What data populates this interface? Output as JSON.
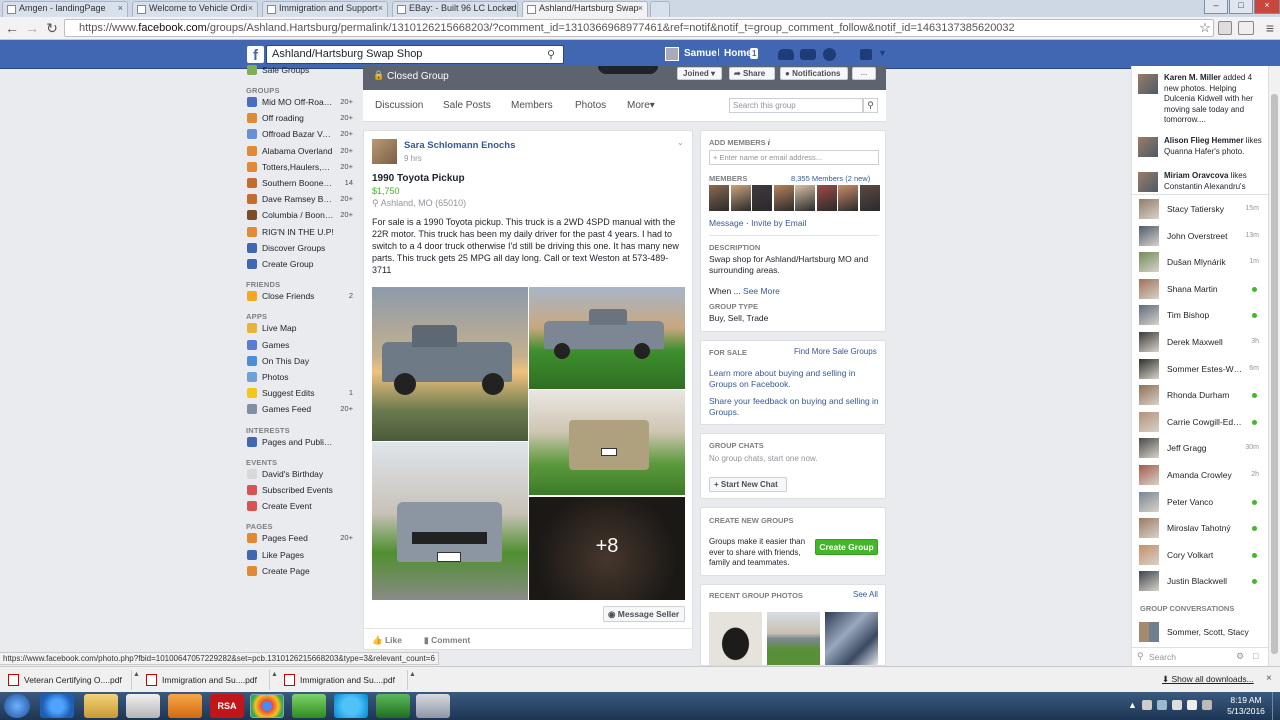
{
  "browser": {
    "tabs": [
      {
        "label": "Amgen - landingPage",
        "active": false
      },
      {
        "label": "Welcome to Vehicle Ordi",
        "active": false
      },
      {
        "label": "Immigration and Support",
        "active": false
      },
      {
        "label": "EBay: - Built 96 LC Locked",
        "active": false
      },
      {
        "label": "Ashland/Hartsburg Swap",
        "active": true
      }
    ],
    "url_prefix": "https://www.",
    "url_domain": "facebook.com",
    "url_rest": "/groups/Ashland.Hartsburg/permalink/1310126215668203/?comment_id=1310366968977461&ref=notif&notif_t=group_comment_follow&notif_id=1463137385620032"
  },
  "fb": {
    "search_value": "Ashland/Hartsburg Swap Shop",
    "user_name": "Samuel",
    "home_label": "Home",
    "home_count": "1"
  },
  "left_nav": {
    "top_item": "Sale Groups",
    "groups_header": "GROUPS",
    "groups": [
      {
        "label": "Mid MO Off-Road ...",
        "count": "20+",
        "color": "#4b6dbf"
      },
      {
        "label": "Off roading",
        "count": "20+",
        "color": "#e08a36"
      },
      {
        "label": "Offroad Bazar Veci...",
        "count": "20+",
        "color": "#6a8fd6"
      },
      {
        "label": "Alabama Overland",
        "count": "20+",
        "color": "#e08a36"
      },
      {
        "label": "Totters,Haulers,To...",
        "count": "20+",
        "color": "#e08a36"
      },
      {
        "label": "Southern Boone Ch...",
        "count": "14",
        "color": "#c46b2f"
      },
      {
        "label": "Dave Ramsey Bab...",
        "count": "20+",
        "color": "#c46b2f"
      },
      {
        "label": "Columbia / Boone ...",
        "count": "20+",
        "color": "#7a4d2b"
      },
      {
        "label": "RIG'N IN THE U.P!",
        "count": "",
        "color": "#e08a36"
      },
      {
        "label": "Discover Groups",
        "count": "",
        "color": "#4267b2"
      },
      {
        "label": "Create Group",
        "count": "",
        "color": "#4267b2"
      }
    ],
    "friends_header": "FRIENDS",
    "friends": [
      {
        "label": "Close Friends",
        "count": "2",
        "color": "#f5a623"
      }
    ],
    "apps_header": "APPS",
    "apps": [
      {
        "label": "Live Map",
        "count": "",
        "color": "#e8b339"
      },
      {
        "label": "Games",
        "count": "",
        "color": "#5b7bd5"
      },
      {
        "label": "On This Day",
        "count": "",
        "color": "#4b8ed9"
      },
      {
        "label": "Photos",
        "count": "",
        "color": "#6fa0d8"
      },
      {
        "label": "Suggest Edits",
        "count": "1",
        "color": "#f5c518"
      },
      {
        "label": "Games Feed",
        "count": "20+",
        "color": "#7f8fa6"
      }
    ],
    "interests_header": "INTERESTS",
    "interests": [
      {
        "label": "Pages and Public F...",
        "count": "",
        "color": "#4267b2"
      }
    ],
    "events_header": "EVENTS",
    "events": [
      {
        "label": "David's Birthday",
        "count": "",
        "color": "#d9d9d9"
      },
      {
        "label": "Subscribed Events",
        "count": "",
        "color": "#d9534f"
      },
      {
        "label": "Create Event",
        "count": "",
        "color": "#d9534f"
      }
    ],
    "pages_header": "PAGES",
    "pages": [
      {
        "label": "Pages Feed",
        "count": "20+",
        "color": "#e08a36"
      },
      {
        "label": "Like Pages",
        "count": "",
        "color": "#4267b2"
      },
      {
        "label": "Create Page",
        "count": "",
        "color": "#e08a36"
      }
    ]
  },
  "group": {
    "privacy": "Closed Group",
    "joined_label": "Joined",
    "share_label": "Share",
    "notifications_label": "Notifications",
    "more_dots": "...",
    "tabs": [
      "Discussion",
      "Sale Posts",
      "Members",
      "Photos",
      "More"
    ],
    "search_placeholder": "Search this group"
  },
  "post": {
    "author": "Sara Schlomann Enochs",
    "time": "9 hrs",
    "title": "1990 Toyota Pickup",
    "price": "$1,750",
    "location": "Ashland, MO (65010)",
    "body": "For sale is a 1990 Toyota pickup. This truck is a 2WD 4SPD manual with the 22R motor. This truck has been my daily driver for the past 4 years. I had to switch to a 4 door truck otherwise I'd still be driving this one. It has many new parts. This truck gets 25 MPG all day long. Call or text Weston at 573-489-3711",
    "more_photos": "+8",
    "message_seller": "Message Seller",
    "like_label": "Like",
    "comment_label": "Comment"
  },
  "right": {
    "add_members_header": "ADD MEMBERS",
    "add_members_placeholder": "+ Enter name or email address...",
    "members_header": "MEMBERS",
    "members_count": "8,355 Members (2 new)",
    "message_link": "Message",
    "invite_link": "Invite by Email",
    "description_header": "DESCRIPTION",
    "description": "Swap shop for Ashland/Hartsburg MO and surrounding areas.",
    "when_text": "When ...",
    "see_more": "See More",
    "group_type_header": "GROUP TYPE",
    "group_type": "Buy, Sell, Trade",
    "for_sale_header": "FOR SALE",
    "find_more": "Find More Sale Groups",
    "learn_more": "Learn more about buying and selling in Groups on Facebook.",
    "share_feedback": "Share your feedback on buying and selling in Groups.",
    "group_chats_header": "GROUP CHATS",
    "no_chats": "No group chats, start one now.",
    "start_chat": "+ Start New Chat",
    "create_groups_header": "CREATE NEW GROUPS",
    "create_groups_text": "Groups make it easier than ever to share with friends, family and teammates.",
    "create_group_btn": "Create Group",
    "recent_photos_header": "RECENT GROUP PHOTOS",
    "see_all": "See All"
  },
  "chat": {
    "tickers": [
      {
        "name": "Karen M. Miller",
        "text": " added 4 new photos. Helping Dulcenia Kidwell with her moving sale today and tomorrow...."
      },
      {
        "name": "Alison Flieg Hemmer",
        "text": " likes Quanna Hafer's photo."
      },
      {
        "name": "Miriam Oravcova",
        "text": " likes Constantin Alexandru's"
      }
    ],
    "contacts": [
      {
        "name": "Stacy Tatiersky",
        "status": "15m",
        "online": false
      },
      {
        "name": "John Overstreet",
        "status": "13m",
        "online": false
      },
      {
        "name": "Dušan Mlynárik",
        "status": "1m",
        "online": false
      },
      {
        "name": "Shana Martin",
        "status": "",
        "online": true
      },
      {
        "name": "Tim Bishop",
        "status": "",
        "online": true
      },
      {
        "name": "Derek Maxwell",
        "status": "3h",
        "online": false
      },
      {
        "name": "Sommer Estes-Wiley",
        "status": "6m",
        "online": false
      },
      {
        "name": "Rhonda Durham",
        "status": "",
        "online": true
      },
      {
        "name": "Carrie Cowgill-Edw...",
        "status": "",
        "online": true
      },
      {
        "name": "Jeff Gragg",
        "status": "30m",
        "online": false
      },
      {
        "name": "Amanda Crowley",
        "status": "2h",
        "online": false
      },
      {
        "name": "Peter Vanco",
        "status": "",
        "online": true
      },
      {
        "name": "Miroslav Tahotný",
        "status": "",
        "online": true
      },
      {
        "name": "Cory Volkart",
        "status": "",
        "online": true
      },
      {
        "name": "Justin Blackwell",
        "status": "",
        "online": true
      }
    ],
    "conversations_header": "GROUP CONVERSATIONS",
    "conversation": "Sommer, Scott, Stacy",
    "search_placeholder": "Search"
  },
  "status_url": "https://www.facebook.com/photo.php?fbid=10100647057229282&set=pcb.1310126215668203&type=3&relevant_count=6",
  "downloads": {
    "items": [
      "Veteran Certifying O....pdf",
      "Immigration and Su....pdf",
      "Immigration and Su....pdf"
    ],
    "show_all": "Show all downloads..."
  },
  "taskbar": {
    "rsa_label": "RSA",
    "time": "8:19 AM",
    "date": "5/13/2016"
  }
}
